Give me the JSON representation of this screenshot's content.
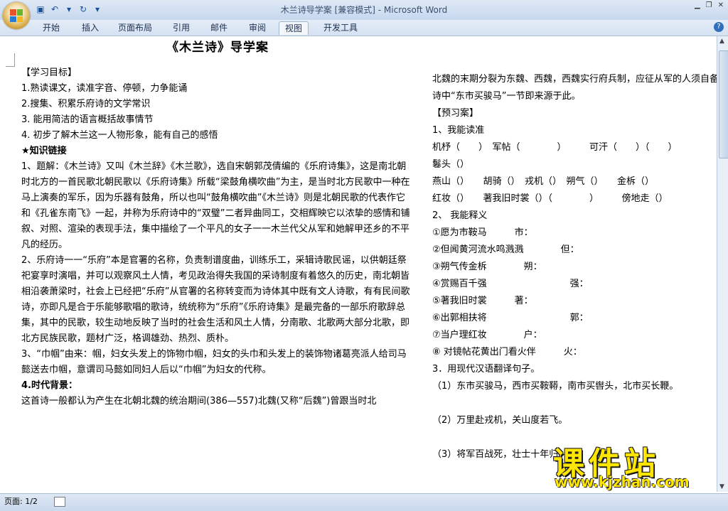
{
  "window": {
    "title": "木兰诗导学案 [兼容模式] - Microsoft Word"
  },
  "ribbon": {
    "tabs": [
      "开始",
      "插入",
      "页面布局",
      "引用",
      "邮件",
      "审阅",
      "视图",
      "开发工具"
    ],
    "active": "视图"
  },
  "status": {
    "page": "页面: 1/2"
  },
  "watermark": {
    "text": "课件站",
    "url": "www.kjzhan.com"
  },
  "doc": {
    "title": "《木兰诗》导学案",
    "left": [
      "【学习目标】",
      "1.熟读课文，读准字音、停顿，力争能诵",
      "2.搜集、积累乐府诗的文学常识",
      "3. 能用简洁的语言概括故事情节",
      "4. 初步了解木兰这一人物形象，能有自己的感悟",
      "★知识链接",
      "1、题解：《木兰诗》又叫《木兰辞》《木兰歌》，选自宋朝郭茂倩编的《乐府诗集》，这是南北朝时北方的一首民歌北朝民歌以《乐府诗集》所载“梁鼓角横吹曲”为主，是当时北方民歌中一种在马上演奏的军乐，因为乐器有鼓角，所以也叫“鼓角横吹曲”《木兰诗》则是北朝民歌的代表作它和《孔雀东南飞》一起，并称为乐府诗中的“双璧”二者异曲同工，交相辉映它以浓挚的感情和铺叙、对照、渲染的表现手法，集中描绘了一个平凡的女子一一木兰代父从军和她解甲还乡的不平凡的经历。",
      "2、乐府诗一一“乐府”本是官署的名称，负责制谱度曲，训练乐工，采辑诗歌民谣，以供朝廷祭祀宴享时演唱，并可以观察风土人情，考见政治得失我国的采诗制度有着悠久的历史，南北朝皆相沿袭萧梁时，社会上已经把“乐府”从官署的名称转变而为诗体其中既有文人诗歌，有有民间歌诗，亦即凡是合于乐能够歌唱的歌诗，统统称为“乐府”《乐府诗集》是最完备的一部乐府歌辞总集，其中的民歌，较生动地反映了当时的社会生活和风土人情，分南歌、北歌两大部分北歌，即北方民族民歌，题材广泛，格调雄劲、热烈、质朴。",
      "3、“巾帼”由来：帼，妇女头发上的饰物巾帼，妇女的头巾和头发上的装饰物诸葛亮派人给司马懿送去巾帼，意谓司马懿如同妇人后以“巾帼”为妇女的代称。",
      "4.时代背景：",
      "这首诗一般都认为产生在北朝北魏的统治期间(386—557)北魏(又称“后魏”)曾跟当时北"
    ],
    "right": [
      "北魏的末期分裂为东魏、西魏，西魏实行府兵制，应征从军的人须自备",
      "诗中“东市买骏马”一节即来源于此。",
      "【预习案】",
      "1、我能读准",
      "机杼（　　）　军帖（　　　　）　　　可汗（　　）（　　）",
      "鬈头（）",
      "燕山（）　　胡骑（）　戎机（）　朔气（）　　金柝（）",
      "红妆（）　　著我旧时裳（）（　　　　）　　　傍地走（）",
      "2、 我能释义",
      "①愿为市鞍马　　　市：",
      "②但闻黄河流水鸣溅溅　　　　但：",
      "③朔气传金柝　　　　朔：",
      "④赏赐百千强　　　　　　　　　强：",
      "⑤著我旧时裳　　　著：",
      "⑥出郭相扶将　　　　　　　　　郭：",
      "⑦当户理红妆　　　　户：",
      "⑧ 对镜帖花黄出门看火伴　　　火：",
      "3．用现代汉语翻译句子。",
      "（1）东市买骏马，西市买鞍鞯，南市买辔头，北市买长鞭。",
      "",
      "（2）万里赴戎机，关山度若飞。",
      "",
      "（3）将军百战死，壮士十年归。",
      ""
    ]
  }
}
